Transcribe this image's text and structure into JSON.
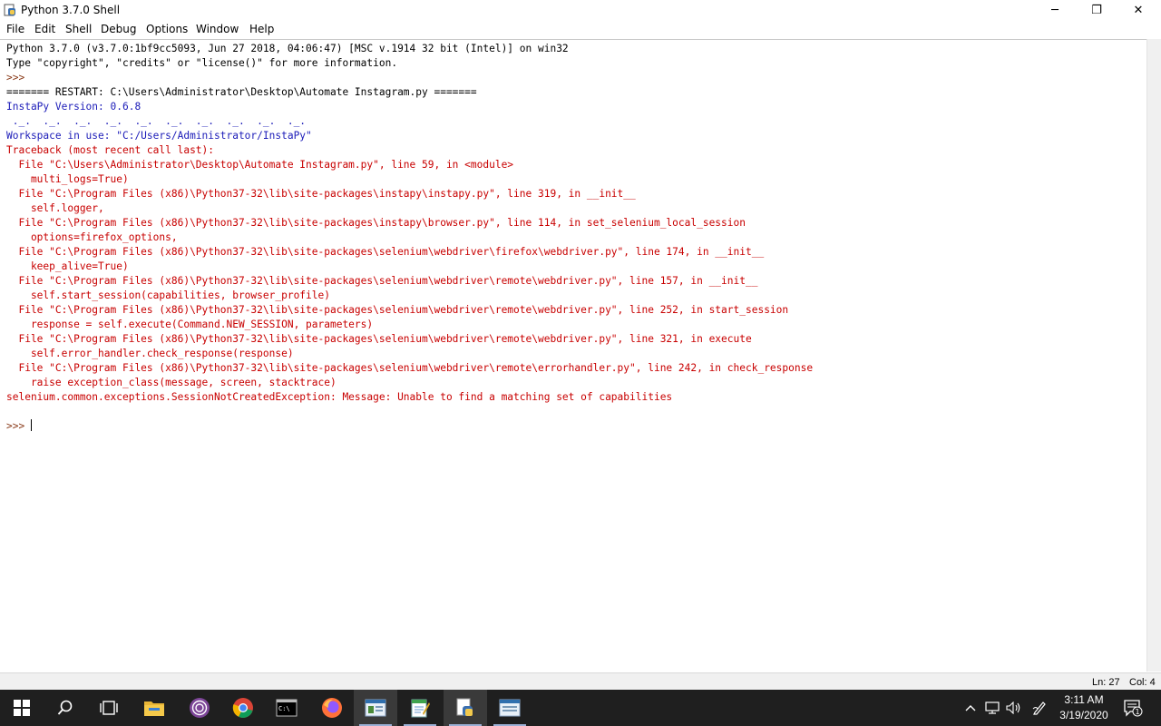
{
  "window": {
    "title": "Python 3.7.0 Shell",
    "minimize_glyph": "─",
    "restore_glyph": "❐",
    "close_glyph": "✕"
  },
  "menu": [
    "File",
    "Edit",
    "Shell",
    "Debug",
    "Options",
    "Window",
    "Help"
  ],
  "shell": {
    "lines": [
      {
        "text": "Python 3.7.0 (v3.7.0:1bf9cc5093, Jun 27 2018, 04:06:47) [MSC v.1914 32 bit (Intel)] on win32",
        "style": "out"
      },
      {
        "text": "Type \"copyright\", \"credits\" or \"license()\" for more information.",
        "style": "out"
      },
      {
        "text": ">>> ",
        "style": "prompt"
      },
      {
        "text": "======= RESTART: C:\\Users\\Administrator\\Desktop\\Automate Instagram.py =======",
        "style": "out"
      },
      {
        "text": "InstaPy Version: 0.6.8",
        "style": "blue"
      },
      {
        "text": " ._.  ._.  ._.  ._.  ._.  ._.  ._.  ._.  ._.  ._.",
        "style": "blue"
      },
      {
        "text": "Workspace in use: \"C:/Users/Administrator/InstaPy\"",
        "style": "blue"
      },
      {
        "text": "Traceback (most recent call last):",
        "style": "red"
      },
      {
        "text": "  File \"C:\\Users\\Administrator\\Desktop\\Automate Instagram.py\", line 59, in <module>",
        "style": "red"
      },
      {
        "text": "    multi_logs=True)",
        "style": "red"
      },
      {
        "text": "  File \"C:\\Program Files (x86)\\Python37-32\\lib\\site-packages\\instapy\\instapy.py\", line 319, in __init__",
        "style": "red"
      },
      {
        "text": "    self.logger,",
        "style": "red"
      },
      {
        "text": "  File \"C:\\Program Files (x86)\\Python37-32\\lib\\site-packages\\instapy\\browser.py\", line 114, in set_selenium_local_session",
        "style": "red"
      },
      {
        "text": "    options=firefox_options,",
        "style": "red"
      },
      {
        "text": "  File \"C:\\Program Files (x86)\\Python37-32\\lib\\site-packages\\selenium\\webdriver\\firefox\\webdriver.py\", line 174, in __init__",
        "style": "red"
      },
      {
        "text": "    keep_alive=True)",
        "style": "red"
      },
      {
        "text": "  File \"C:\\Program Files (x86)\\Python37-32\\lib\\site-packages\\selenium\\webdriver\\remote\\webdriver.py\", line 157, in __init__",
        "style": "red"
      },
      {
        "text": "    self.start_session(capabilities, browser_profile)",
        "style": "red"
      },
      {
        "text": "  File \"C:\\Program Files (x86)\\Python37-32\\lib\\site-packages\\selenium\\webdriver\\remote\\webdriver.py\", line 252, in start_session",
        "style": "red"
      },
      {
        "text": "    response = self.execute(Command.NEW_SESSION, parameters)",
        "style": "red"
      },
      {
        "text": "  File \"C:\\Program Files (x86)\\Python37-32\\lib\\site-packages\\selenium\\webdriver\\remote\\webdriver.py\", line 321, in execute",
        "style": "red"
      },
      {
        "text": "    self.error_handler.check_response(response)",
        "style": "red"
      },
      {
        "text": "  File \"C:\\Program Files (x86)\\Python37-32\\lib\\site-packages\\selenium\\webdriver\\remote\\errorhandler.py\", line 242, in check_response",
        "style": "red"
      },
      {
        "text": "    raise exception_class(message, screen, stacktrace)",
        "style": "red"
      },
      {
        "text": "selenium.common.exceptions.SessionNotCreatedException: Message: Unable to find a matching set of capabilities",
        "style": "red"
      },
      {
        "text": "",
        "style": "out"
      },
      {
        "text": ">>> ",
        "style": "prompt"
      }
    ]
  },
  "status": {
    "line": "Ln: 27",
    "col": "Col: 4"
  },
  "taskbar": {
    "items": [
      {
        "name": "start-button",
        "icon": "windows-logo-icon"
      },
      {
        "name": "search-button",
        "icon": "search-icon"
      },
      {
        "name": "task-view-button",
        "icon": "task-view-icon"
      },
      {
        "name": "file-explorer-button",
        "icon": "folder-icon"
      },
      {
        "name": "tor-app-button",
        "icon": "tor-icon"
      },
      {
        "name": "chrome-button",
        "icon": "chrome-icon"
      },
      {
        "name": "command-prompt-button",
        "icon": "terminal-icon"
      },
      {
        "name": "firefox-button",
        "icon": "firefox-icon"
      },
      {
        "name": "remote-window-button",
        "icon": "window-icon"
      },
      {
        "name": "notepad-button",
        "icon": "notepad-icon"
      },
      {
        "name": "python-idle-button",
        "icon": "python-file-icon"
      },
      {
        "name": "another-window-button",
        "icon": "window-icon"
      }
    ],
    "time": "3:11 AM",
    "date": "3/19/2020",
    "notification_count": "1"
  },
  "colors": {
    "traceback": "#c80000",
    "info": "#1b1bb8",
    "taskbar": "#1f1f1f"
  }
}
